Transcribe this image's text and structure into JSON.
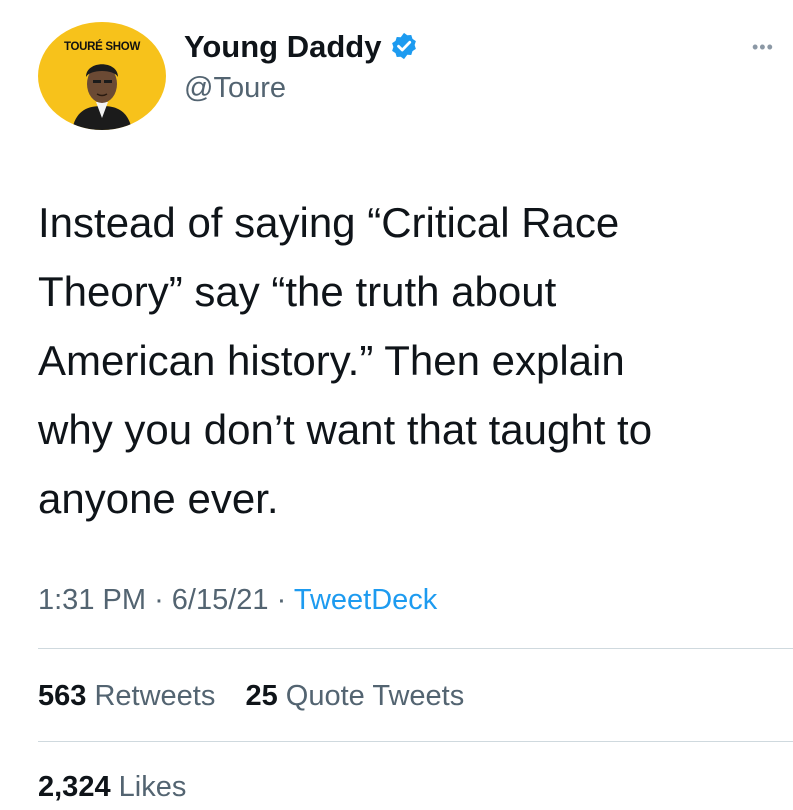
{
  "author": {
    "avatar_label": "TOURÉ SHOW",
    "name": "Young Daddy",
    "handle": "@Toure",
    "verified_icon": "verified-badge-icon",
    "more_icon": "more-options-icon"
  },
  "tweet": {
    "text": "Instead of saying “Critical Race\nTheory” say “the truth about\nAmerican history.” Then explain\nwhy you don’t want that taught to\nanyone ever.",
    "time": "1:31 PM",
    "separator": "·",
    "date": "6/15/21",
    "source": "TweetDeck"
  },
  "stats": {
    "retweets_count": "563",
    "retweets_label": "Retweets",
    "quote_count": "25",
    "quote_label": "Quote Tweets",
    "likes_count": "2,324",
    "likes_label": "Likes"
  },
  "colors": {
    "accent": "#1d9bf0",
    "avatar_bg": "#f7c21b",
    "secondary_text": "#536471"
  }
}
